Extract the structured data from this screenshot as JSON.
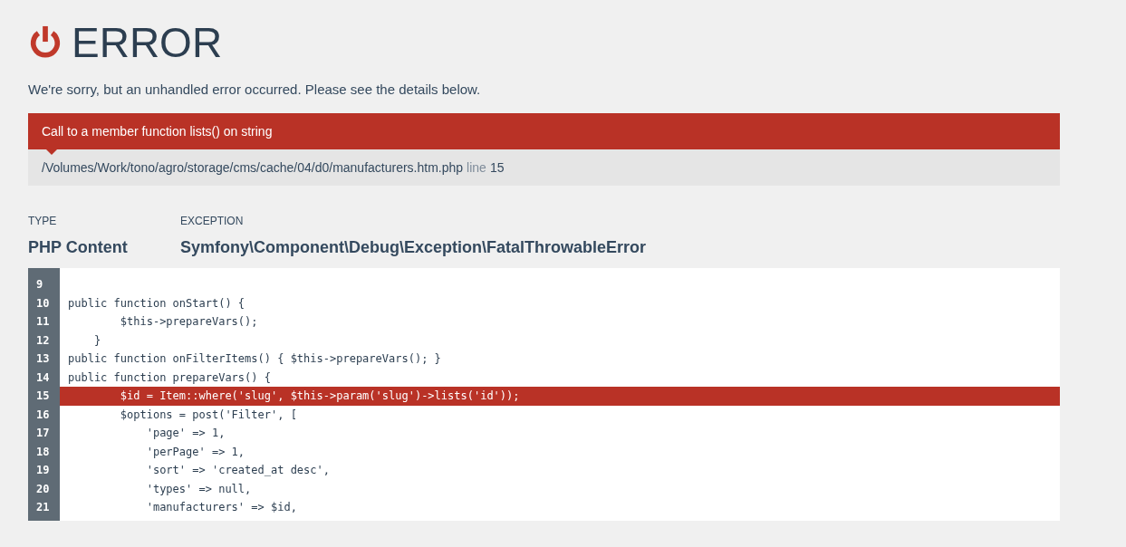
{
  "header": {
    "title": "ERROR",
    "message": "We're sorry, but an unhandled error occurred. Please see the details below."
  },
  "error": {
    "message": "Call to a member function lists() on string",
    "file": "/Volumes/Work/tono/agro/storage/cms/cache/04/d0/manufacturers.htm.php",
    "line_label": "line",
    "line": "15"
  },
  "details": [
    {
      "label": "TYPE",
      "value": "PHP Content"
    },
    {
      "label": "EXCEPTION",
      "value": "Symfony\\Component\\Debug\\Exception\\FatalThrowableError"
    }
  ],
  "code": [
    {
      "number": "9",
      "highlighted": false
    },
    {
      "number": "10",
      "text": "public function onStart() {",
      "highlighted": false
    },
    {
      "number": "11",
      "text": "        $this->prepareVars();",
      "highlighted": false
    },
    {
      "number": "12",
      "text": "    }",
      "highlighted": false
    },
    {
      "number": "13",
      "text": "public function onFilterItems() { $this->prepareVars(); }",
      "highlighted": false
    },
    {
      "number": "14",
      "text": "public function prepareVars() {",
      "highlighted": false
    },
    {
      "number": "15",
      "text": "        $id = Item::where('slug', $this->param('slug')->lists('id'));",
      "highlighted": true
    },
    {
      "number": "16",
      "text": "        $options = post('Filter', [",
      "highlighted": false
    },
    {
      "number": "17",
      "text": "            'page' => 1,",
      "highlighted": false
    },
    {
      "number": "18",
      "text": "            'perPage' => 1,",
      "highlighted": false
    },
    {
      "number": "19",
      "text": "            'sort' => 'created_at desc',",
      "highlighted": false
    },
    {
      "number": "20",
      "text": "            'types' => null,",
      "highlighted": false
    },
    {
      "number": "21",
      "text": "            'manufacturers' => $id,",
      "highlighted": false
    }
  ]
}
